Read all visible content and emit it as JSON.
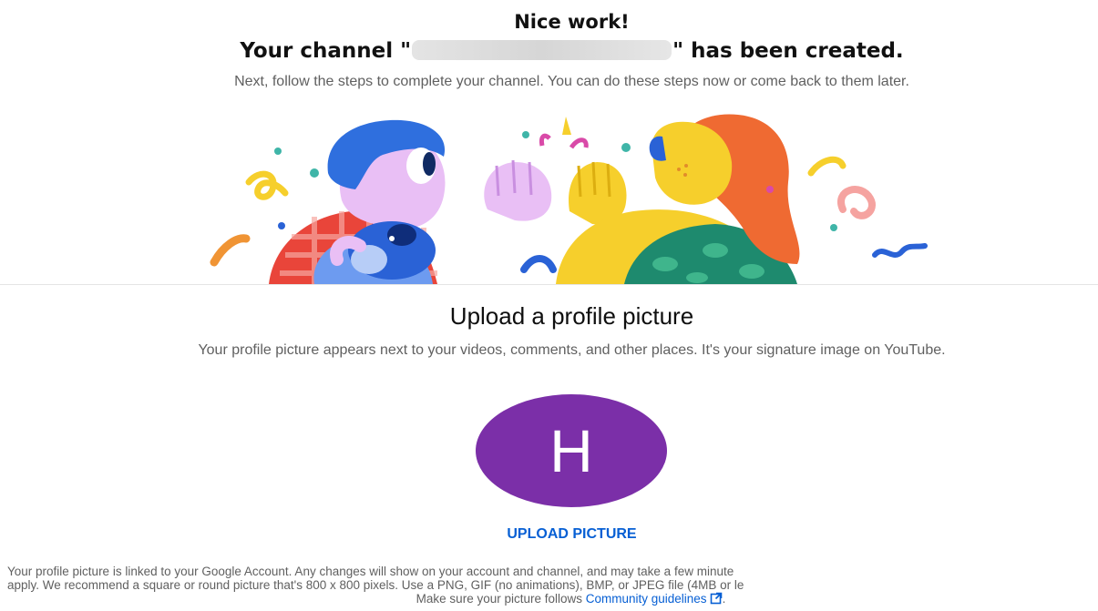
{
  "header": {
    "heading": "Nice work!",
    "channel_prefix": "Your channel \"",
    "channel_name_redacted": "",
    "channel_suffix": "\" has been created.",
    "subtitle": "Next, follow the steps to complete your channel. You can do these steps now or come back to them later."
  },
  "profile_picture": {
    "title": "Upload a profile picture",
    "description": "Your profile picture appears next to your videos, comments, and other places. It's your signature image on YouTube.",
    "avatar_letter": "H",
    "avatar_color": "#7b2fa8",
    "upload_label": "UPLOAD PICTURE",
    "upload_color": "#065fd4"
  },
  "notice": {
    "line1": "Your profile picture is linked to your Google Account. Any changes will show on your account and channel, and may take a few minute",
    "line2": "apply. We recommend a square or round picture that's 800 x 800 pixels. Use a PNG, GIF (no animations), BMP, or JPEG file (4MB or le",
    "line3_prefix": "Make sure your picture follows ",
    "link_label": "Community guidelines",
    "line3_suffix": ".",
    "link_icon": "external-link-icon"
  }
}
